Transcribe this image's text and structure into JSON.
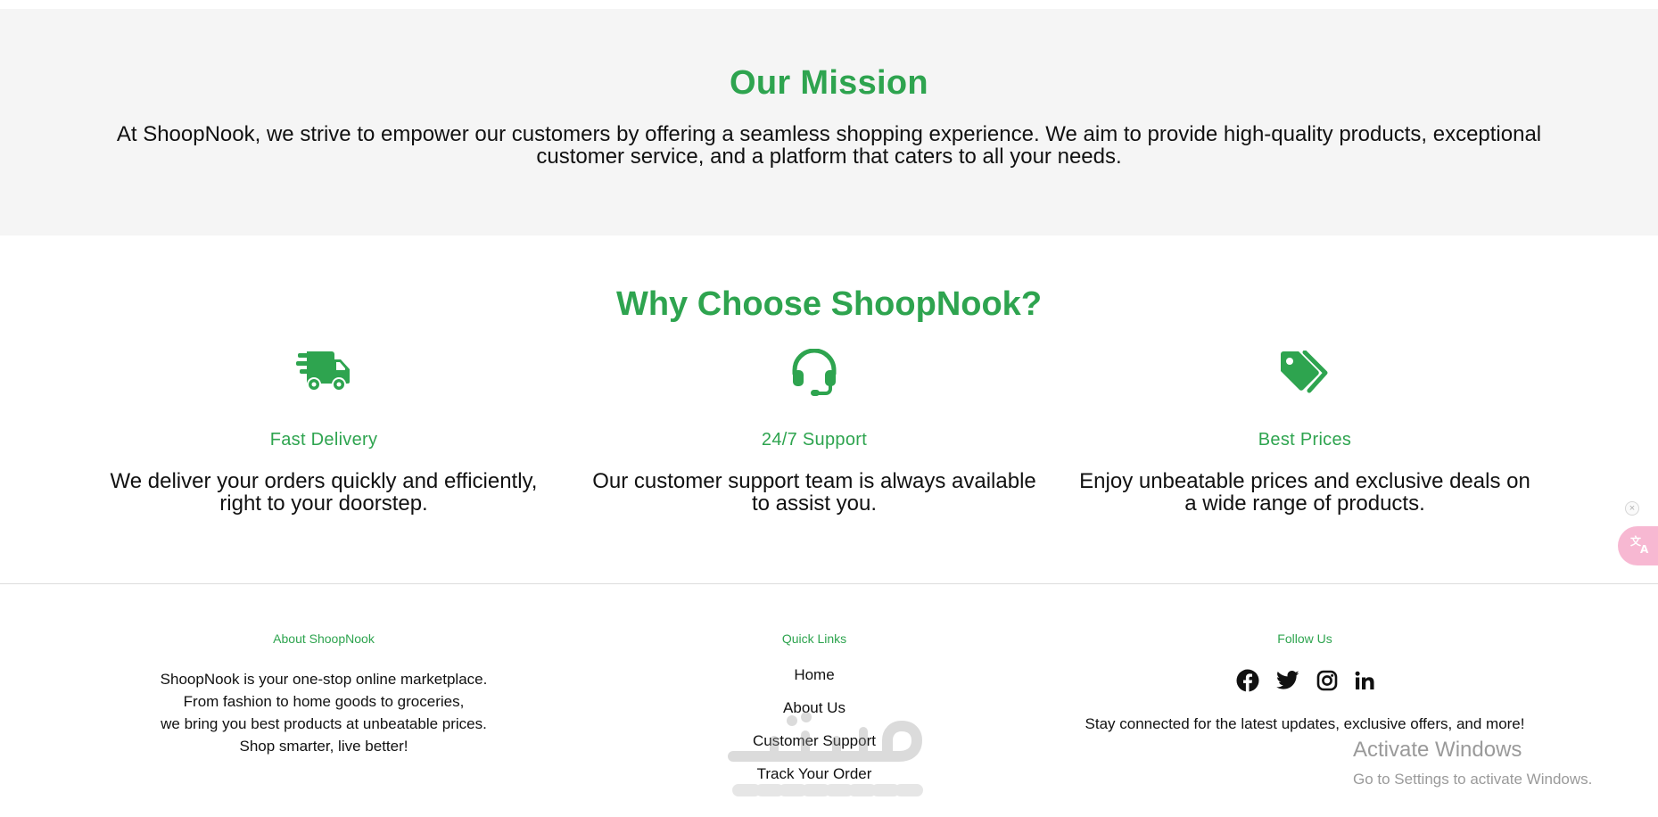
{
  "mission": {
    "title": "Our Mission",
    "text": "At ShoopNook, we strive to empower our customers by offering a seamless shopping experience. We aim to provide high-quality products, exceptional customer service, and a platform that caters to all your needs."
  },
  "why": {
    "title": "Why Choose ShoopNook?",
    "features": [
      {
        "icon": "truck-fast-icon",
        "title": "Fast Delivery",
        "text": "We deliver your orders quickly and efficiently, right to your doorstep."
      },
      {
        "icon": "headset-icon",
        "title": "24/7 Support",
        "text": "Our customer support team is always available to assist you."
      },
      {
        "icon": "tags-icon",
        "title": "Best Prices",
        "text": "Enjoy unbeatable prices and exclusive deals on a wide range of products."
      }
    ]
  },
  "footer": {
    "about": {
      "heading": "About ShoopNook",
      "lines": [
        "ShoopNook is your one-stop online marketplace.",
        "From fashion to home goods to groceries,",
        "we bring you best products at unbeatable prices.",
        "Shop smarter, live better!"
      ]
    },
    "quick_links": {
      "heading": "Quick Links",
      "links": [
        "Home",
        "About Us",
        "Customer Support",
        "Track Your Order"
      ]
    },
    "follow": {
      "heading": "Follow Us",
      "icons": [
        "facebook-icon",
        "twitter-icon",
        "instagram-icon",
        "linkedin-icon"
      ],
      "text": "Stay connected for the latest updates, exclusive offers, and more!"
    }
  },
  "overlays": {
    "activate_title": "Activate Windows",
    "activate_sub": "Go to Settings to activate Windows.",
    "translate_close": "×",
    "watermark_text": "مستقل mostaql.com"
  },
  "colors": {
    "accent": "#2ea44f",
    "section_bg": "#f5f5f5",
    "text": "#111111",
    "translate_tab": "#f7b8d2"
  }
}
